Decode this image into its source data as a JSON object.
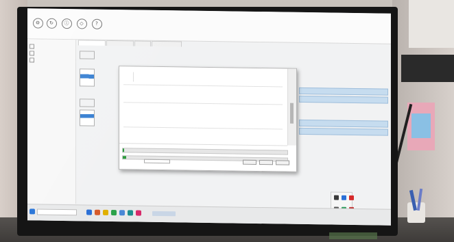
{
  "window": {
    "title": ""
  },
  "ribbon": {
    "menu": [
      "",
      "",
      "",
      "",
      "",
      ""
    ],
    "tools": [
      {
        "icon": "gear-icon",
        "label": ""
      },
      {
        "icon": "refresh-icon",
        "label": ""
      },
      {
        "icon": "info-icon",
        "label": ""
      },
      {
        "icon": "code-icon",
        "label": ""
      },
      {
        "icon": "help-icon",
        "label": ""
      }
    ]
  },
  "progress": {
    "first": 0.01,
    "second": 0.02
  },
  "dialog": {
    "buttons": [
      "",
      "",
      ""
    ]
  },
  "taskbar": {
    "search_placeholder": "",
    "pinned_colors": [
      "#2a6fd6",
      "#d65a2a",
      "#e0b000",
      "#2ca24a",
      "#4a88d6",
      "#1d8f8f",
      "#d62a6a"
    ]
  },
  "tray_popup_colors": [
    "#3a3a3a",
    "#2a6fd6",
    "#d62a2a",
    "#555555",
    "#2a9a5a",
    "#c23a3a"
  ]
}
